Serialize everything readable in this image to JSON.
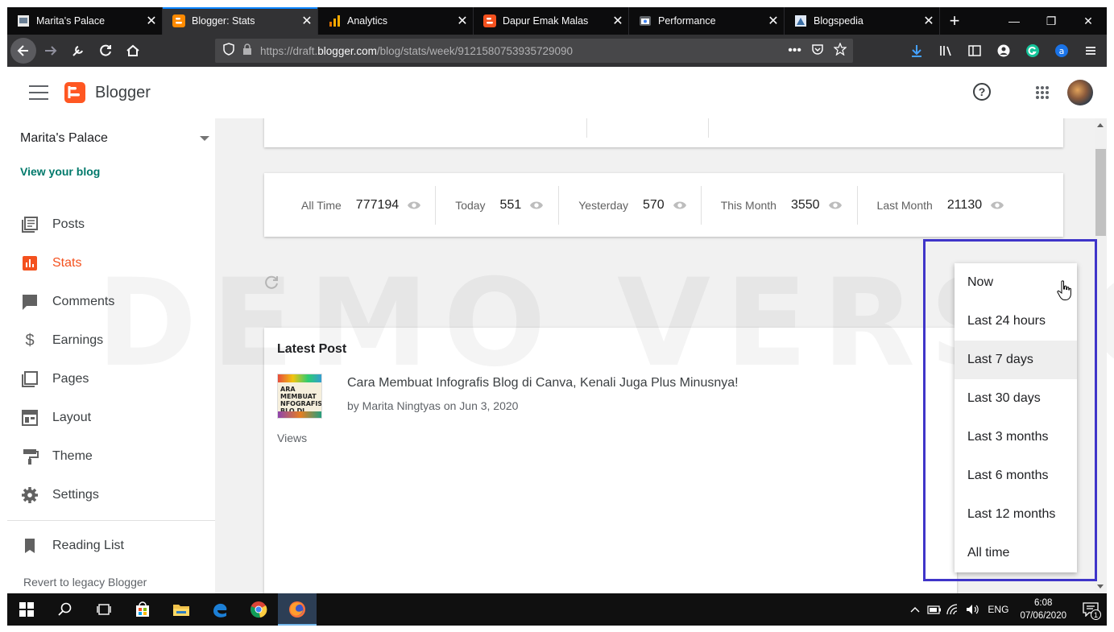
{
  "browser": {
    "tabs": [
      {
        "title": "Marita's Palace",
        "icon": "blog-favicon"
      },
      {
        "title": "Blogger: Stats",
        "icon": "blogger-favicon",
        "active": true
      },
      {
        "title": "Analytics",
        "icon": "analytics-favicon"
      },
      {
        "title": "Dapur Emak Malas",
        "icon": "blogger-favicon"
      },
      {
        "title": "Performance",
        "icon": "search-console-favicon"
      },
      {
        "title": "Blogspedia",
        "icon": "blog-favicon"
      }
    ],
    "url_prefix": "https://draft.",
    "url_domain": "blogger.com",
    "url_path": "/blog/stats/week/9121580753935729090"
  },
  "header": {
    "title": "Blogger"
  },
  "sidebar": {
    "blog_name": "Marita's Palace",
    "view_blog": "View your blog",
    "items": [
      {
        "label": "Posts",
        "icon": "posts-icon"
      },
      {
        "label": "Stats",
        "icon": "stats-icon",
        "active": true
      },
      {
        "label": "Comments",
        "icon": "comments-icon"
      },
      {
        "label": "Earnings",
        "icon": "dollar-icon"
      },
      {
        "label": "Pages",
        "icon": "pages-icon"
      },
      {
        "label": "Layout",
        "icon": "layout-icon"
      },
      {
        "label": "Theme",
        "icon": "theme-icon"
      },
      {
        "label": "Settings",
        "icon": "gear-icon"
      }
    ],
    "reading_list": "Reading List",
    "revert": "Revert to legacy Blogger"
  },
  "stats": [
    {
      "label": "All Time",
      "value": "777194"
    },
    {
      "label": "Today",
      "value": "551"
    },
    {
      "label": "Yesterday",
      "value": "570"
    },
    {
      "label": "This Month",
      "value": "3550"
    },
    {
      "label": "Last Month",
      "value": "21130"
    }
  ],
  "latest_post": {
    "heading": "Latest Post",
    "title": "Cara Membuat Infografis Blog di Canva, Kenali Juga Plus Minusnya!",
    "meta": "by Marita Ningtyas on Jun 3, 2020",
    "views_label": "Views",
    "thumb_text": "ARA MEMBUAT NFOGRAFIS BLO DI CANVA"
  },
  "watermark": "DEMO VERSION",
  "dropdown": {
    "options": [
      "Now",
      "Last 24 hours",
      "Last 7 days",
      "Last 30 days",
      "Last 3 months",
      "Last 6 months",
      "Last 12 months",
      "All time"
    ],
    "selected": "Last 7 days"
  },
  "taskbar": {
    "language": "ENG",
    "time": "6:08",
    "date": "07/06/2020",
    "notifications": "1"
  },
  "colors": {
    "accent": "#f4511e",
    "link": "#00796b",
    "highlight_border": "#3f35c9"
  }
}
